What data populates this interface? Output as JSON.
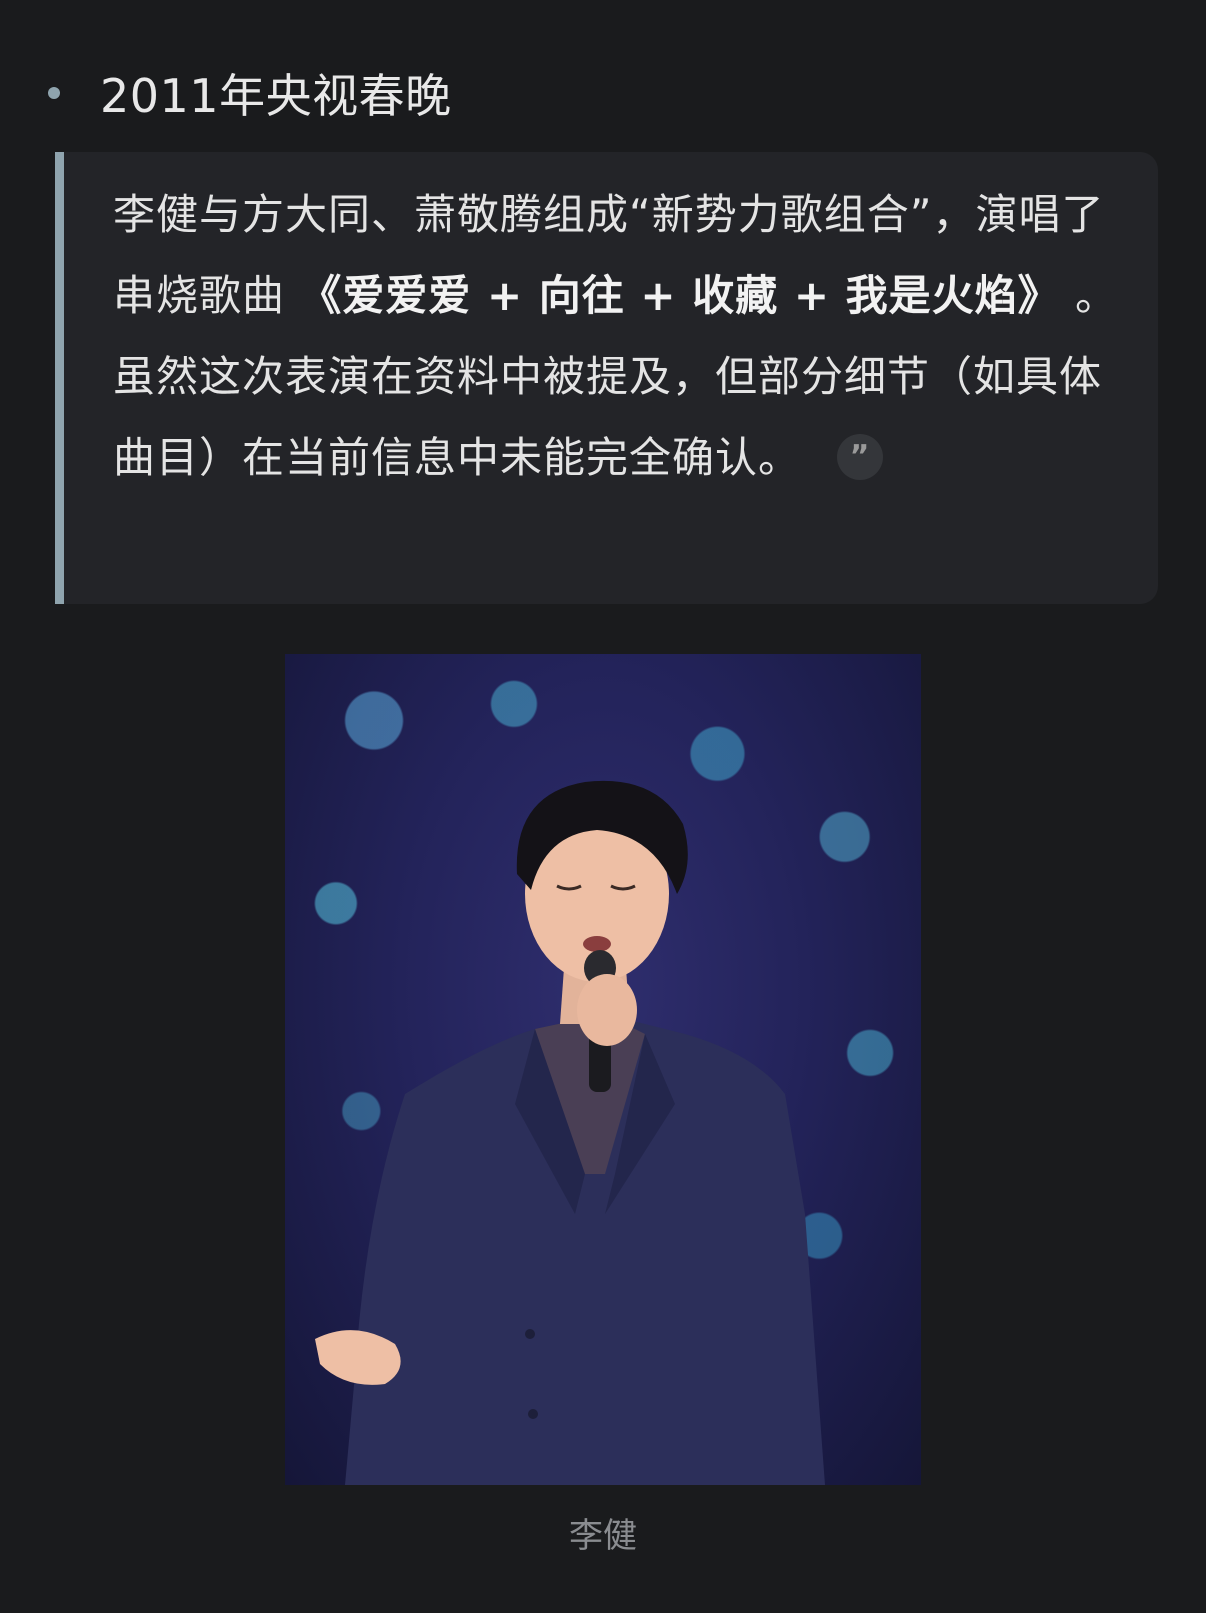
{
  "heading": {
    "text": "2011年央视春晚"
  },
  "quote": {
    "part1": "李健与方大同、萧敬腾组成“新势力歌组合”，演唱了串烧歌曲 ",
    "song_title": "《爱爱爱 + 向往 + 收藏 + 我是火焰》",
    "part2": " 。虽然这次表演在资料中被提及，但部分细节（如具体曲目）在当前信息中未能完全确认。",
    "citation_icon": "quote-icon"
  },
  "image": {
    "caption": "李健"
  }
}
